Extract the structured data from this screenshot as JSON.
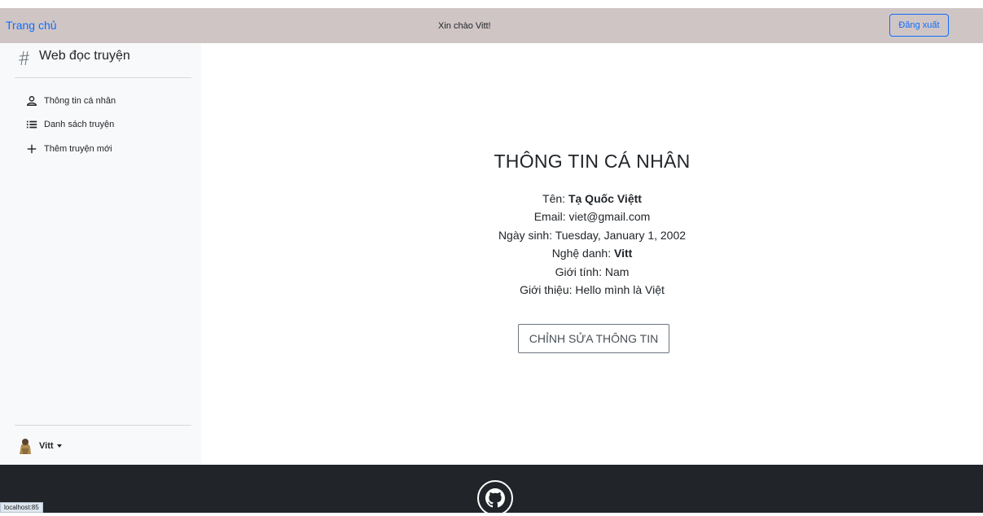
{
  "navbar": {
    "home_label": "Trang chủ",
    "greeting": "Xin chào Vitt!",
    "logout_label": "Đăng xuất"
  },
  "sidebar": {
    "brand": "Web đọc truyện",
    "brand_icon": "hash-icon",
    "items": [
      {
        "label": "Thông tin cá nhân",
        "icon": "person-icon"
      },
      {
        "label": "Danh sách truyện",
        "icon": "list-icon"
      },
      {
        "label": "Thêm truyện mới",
        "icon": "plus-icon"
      }
    ],
    "user": {
      "name": "Vitt",
      "avatar": "avatar-image"
    }
  },
  "profile": {
    "title": "THÔNG TIN CÁ NHÂN",
    "name_label": "Tên: ",
    "name_value": "Tạ Quốc Việtt",
    "email_line": "Email: viet@gmail.com",
    "birthday_line": "Ngày sinh: Tuesday, January 1, 2002",
    "stage_label": "Nghệ danh: ",
    "stage_value": "Vitt",
    "gender_line": "Giới tính: Nam",
    "intro_line": "Giới thiệu: Hello mình là Việt",
    "edit_label": "CHỈNH SỬA THÔNG TIN"
  },
  "footer": {
    "github_icon": "github-icon"
  },
  "status_bar": {
    "url": "localhost:85"
  },
  "colors": {
    "navbar_bg": "#d0c5c5",
    "link": "#0d6efd",
    "sidebar_bg": "#f8f9fa",
    "footer_bg": "#212529"
  }
}
